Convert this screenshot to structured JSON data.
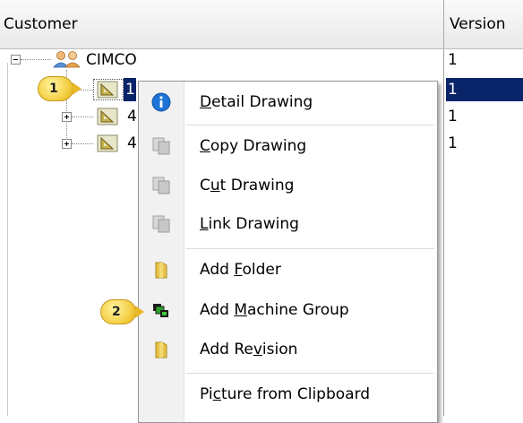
{
  "columns": {
    "customer": "Customer",
    "version": "Version"
  },
  "tree": {
    "root_label": "CIMCO",
    "root_version": "1",
    "child1_label": "1",
    "child1_version": "1",
    "child2_label": "4",
    "child2_version": "1",
    "child3_label": "4",
    "child3_version": "1"
  },
  "context_menu": {
    "detail_pre": "",
    "detail_acc": "D",
    "detail_post": "etail Drawing",
    "copy_pre": "",
    "copy_acc": "C",
    "copy_post": "opy Drawing",
    "cut_pre": "C",
    "cut_acc": "u",
    "cut_post": "t Drawing",
    "link_pre": "",
    "link_acc": "L",
    "link_post": "ink Drawing",
    "folder_pre": "Add ",
    "folder_acc": "F",
    "folder_post": "older",
    "machine_pre": "Add ",
    "machine_acc": "M",
    "machine_post": "achine Group",
    "revision_pre": "Add Re",
    "revision_acc": "v",
    "revision_post": "ision",
    "picture_pre": "Pi",
    "picture_acc": "c",
    "picture_post": "ture from Clipboard"
  },
  "callouts": {
    "first": "1",
    "second": "2"
  },
  "colors": {
    "selection": "#0a246a",
    "info_blue": "#1e73d6",
    "callout_gold": "#f2c93a"
  },
  "icons": [
    "customer-group-icon",
    "drawing-triangle-icon",
    "info-icon",
    "copy-icon",
    "folder-icon",
    "machine-group-icon"
  ]
}
